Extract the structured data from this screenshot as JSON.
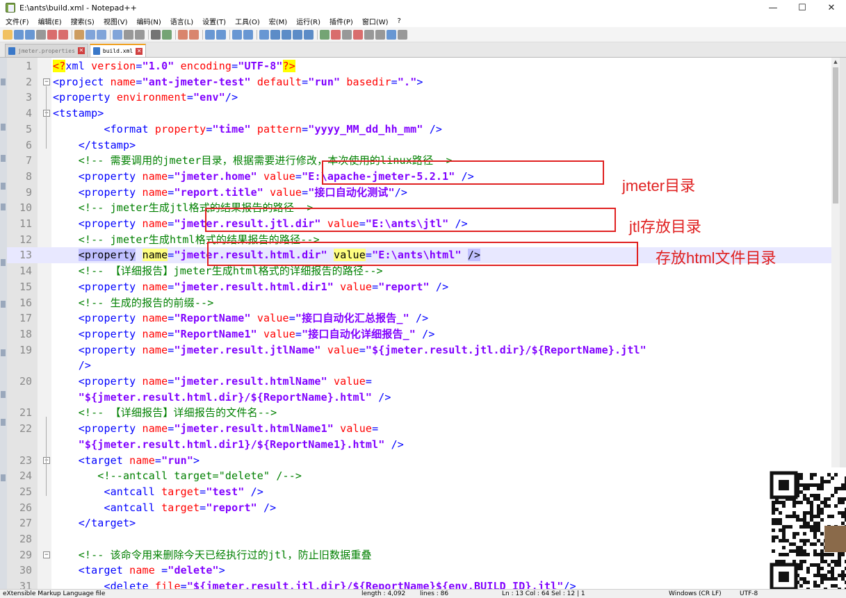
{
  "window": {
    "title": "E:\\ants\\build.xml - Notepad++",
    "controls": [
      "—",
      "☐",
      "✕"
    ]
  },
  "menu": [
    "文件(F)",
    "编辑(E)",
    "搜索(S)",
    "视图(V)",
    "编码(N)",
    "语言(L)",
    "设置(T)",
    "工具(O)",
    "宏(M)",
    "运行(R)",
    "插件(P)",
    "窗口(W)",
    "?"
  ],
  "tabs": [
    {
      "label": "jmeter.properties",
      "active": false
    },
    {
      "label": "build.xml",
      "active": true
    }
  ],
  "colors": {
    "annotation": "#e02020",
    "current_line": "#e8e8ff",
    "tag": "#0000ff",
    "attribute": "#ff0000",
    "value": "#8000ff",
    "comment": "#008000"
  },
  "editor": {
    "current_line": 13,
    "lines": [
      {
        "n": "1",
        "t": [
          [
            "pi",
            "<?"
          ],
          [
            "tag",
            "xml "
          ],
          [
            "attr",
            "version"
          ],
          [
            "tag",
            "="
          ],
          [
            "val",
            "\"1.0\""
          ],
          [
            "tag",
            " "
          ],
          [
            "attr",
            "encoding"
          ],
          [
            "tag",
            "="
          ],
          [
            "val",
            "\"UTF-8\""
          ],
          [
            "pi",
            "?>"
          ]
        ]
      },
      {
        "n": "2",
        "t": [
          [
            "tag",
            "<project "
          ],
          [
            "attr",
            "name"
          ],
          [
            "tag",
            "="
          ],
          [
            "val",
            "\"ant-jmeter-test\""
          ],
          [
            "tag",
            " "
          ],
          [
            "attr",
            "default"
          ],
          [
            "tag",
            "="
          ],
          [
            "val",
            "\"run\""
          ],
          [
            "tag",
            " "
          ],
          [
            "attr",
            "basedir"
          ],
          [
            "tag",
            "="
          ],
          [
            "val",
            "\".\""
          ],
          [
            "tag",
            ">"
          ]
        ]
      },
      {
        "n": "3",
        "t": [
          [
            "tag",
            "<property "
          ],
          [
            "attr",
            "environment"
          ],
          [
            "tag",
            "="
          ],
          [
            "val",
            "\"env\""
          ],
          [
            "tag",
            "/>"
          ]
        ]
      },
      {
        "n": "4",
        "t": [
          [
            "tag",
            "<tstamp>"
          ]
        ]
      },
      {
        "n": "5",
        "t": [
          [
            "tag",
            "        <format "
          ],
          [
            "attr",
            "property"
          ],
          [
            "tag",
            "="
          ],
          [
            "val",
            "\"time\""
          ],
          [
            "tag",
            " "
          ],
          [
            "attr",
            "pattern"
          ],
          [
            "tag",
            "="
          ],
          [
            "val",
            "\"yyyy_MM_dd_hh_mm\""
          ],
          [
            "tag",
            " />"
          ]
        ]
      },
      {
        "n": "6",
        "t": [
          [
            "tag",
            "    </tstamp>"
          ]
        ]
      },
      {
        "n": "7",
        "t": [
          [
            "cmt",
            "    <!-- 需要调用的jmeter目录，根据需要进行修改，本次使用的linux路径-->"
          ]
        ]
      },
      {
        "n": "8",
        "t": [
          [
            "tag",
            "    <property "
          ],
          [
            "attr",
            "name"
          ],
          [
            "tag",
            "="
          ],
          [
            "val",
            "\"jmeter.home\""
          ],
          [
            "tag",
            " "
          ],
          [
            "attr",
            "value"
          ],
          [
            "tag",
            "="
          ],
          [
            "val",
            "\"E:\\apache-jmeter-5.2.1\""
          ],
          [
            "tag",
            " />"
          ]
        ]
      },
      {
        "n": "9",
        "t": [
          [
            "tag",
            "    <property "
          ],
          [
            "attr",
            "name"
          ],
          [
            "tag",
            "="
          ],
          [
            "val",
            "\"report.title\""
          ],
          [
            "tag",
            " "
          ],
          [
            "attr",
            "value"
          ],
          [
            "tag",
            "="
          ],
          [
            "val",
            "\"接口自动化测试\""
          ],
          [
            "tag",
            "/>"
          ]
        ]
      },
      {
        "n": "10",
        "t": [
          [
            "cmt",
            "    <!-- jmeter生成jtl格式的结果报告的路径-->"
          ]
        ]
      },
      {
        "n": "11",
        "t": [
          [
            "tag",
            "    <property "
          ],
          [
            "attr",
            "name"
          ],
          [
            "tag",
            "="
          ],
          [
            "val",
            "\"jmeter.result.jtl.dir\""
          ],
          [
            "tag",
            " "
          ],
          [
            "attr",
            "value"
          ],
          [
            "tag",
            "="
          ],
          [
            "val",
            "\"E:\\ants\\jtl\""
          ],
          [
            "tag",
            " />"
          ]
        ]
      },
      {
        "n": "12",
        "t": [
          [
            "cmt",
            "    <!-- jmeter生成html格式的结果报告的路径-->"
          ]
        ]
      },
      {
        "n": "13",
        "t": [
          [
            "tag",
            "    "
          ],
          [
            "sel",
            "<property"
          ],
          [
            "tag",
            " "
          ],
          [
            "sel-y",
            "name"
          ],
          [
            "tag",
            "="
          ],
          [
            "val",
            "\"jmeter.result.html.dir\""
          ],
          [
            "tag",
            " "
          ],
          [
            "sel-y",
            "value"
          ],
          [
            "tag",
            "="
          ],
          [
            "val",
            "\"E:\\ants\\html\""
          ],
          [
            "tag",
            " "
          ],
          [
            "sel",
            "/>"
          ]
        ]
      },
      {
        "n": "14",
        "t": [
          [
            "cmt",
            "    <!-- 【详细报告】jmeter生成html格式的详细报告的路径-->"
          ]
        ]
      },
      {
        "n": "15",
        "t": [
          [
            "tag",
            "    <property "
          ],
          [
            "attr",
            "name"
          ],
          [
            "tag",
            "="
          ],
          [
            "val",
            "\"jmeter.result.html.dir1\""
          ],
          [
            "tag",
            " "
          ],
          [
            "attr",
            "value"
          ],
          [
            "tag",
            "="
          ],
          [
            "val",
            "\"report\""
          ],
          [
            "tag",
            " />"
          ]
        ]
      },
      {
        "n": "16",
        "t": [
          [
            "cmt",
            "    <!-- 生成的报告的前缀-->"
          ]
        ]
      },
      {
        "n": "17",
        "t": [
          [
            "tag",
            "    <property "
          ],
          [
            "attr",
            "name"
          ],
          [
            "tag",
            "="
          ],
          [
            "val",
            "\"ReportName\""
          ],
          [
            "tag",
            " "
          ],
          [
            "attr",
            "value"
          ],
          [
            "tag",
            "="
          ],
          [
            "val",
            "\"接口自动化汇总报告_\""
          ],
          [
            "tag",
            " />"
          ]
        ]
      },
      {
        "n": "18",
        "t": [
          [
            "tag",
            "    <property "
          ],
          [
            "attr",
            "name"
          ],
          [
            "tag",
            "="
          ],
          [
            "val",
            "\"ReportName1\""
          ],
          [
            "tag",
            " "
          ],
          [
            "attr",
            "value"
          ],
          [
            "tag",
            "="
          ],
          [
            "val",
            "\"接口自动化详细报告_\""
          ],
          [
            "tag",
            " />"
          ]
        ]
      },
      {
        "n": "19",
        "t": [
          [
            "tag",
            "    <property "
          ],
          [
            "attr",
            "name"
          ],
          [
            "tag",
            "="
          ],
          [
            "val",
            "\"jmeter.result.jtlName\""
          ],
          [
            "tag",
            " "
          ],
          [
            "attr",
            "value"
          ],
          [
            "tag",
            "="
          ],
          [
            "val",
            "\"${jmeter.result.jtl.dir}/${ReportName}.jtl\""
          ]
        ]
      },
      {
        "n": "",
        "t": [
          [
            "tag",
            "    />"
          ]
        ]
      },
      {
        "n": "20",
        "t": [
          [
            "tag",
            "    <property "
          ],
          [
            "attr",
            "name"
          ],
          [
            "tag",
            "="
          ],
          [
            "val",
            "\"jmeter.result.htmlName\""
          ],
          [
            "tag",
            " "
          ],
          [
            "attr",
            "value"
          ],
          [
            "tag",
            "="
          ]
        ]
      },
      {
        "n": "",
        "t": [
          [
            "val",
            "    \"${jmeter.result.html.dir}/${ReportName}.html\""
          ],
          [
            "tag",
            " />"
          ]
        ]
      },
      {
        "n": "21",
        "t": [
          [
            "cmt",
            "    <!-- 【详细报告】详细报告的文件名-->"
          ]
        ]
      },
      {
        "n": "22",
        "t": [
          [
            "tag",
            "    <property "
          ],
          [
            "attr",
            "name"
          ],
          [
            "tag",
            "="
          ],
          [
            "val",
            "\"jmeter.result.htmlName1\""
          ],
          [
            "tag",
            " "
          ],
          [
            "attr",
            "value"
          ],
          [
            "tag",
            "="
          ]
        ]
      },
      {
        "n": "",
        "t": [
          [
            "val",
            "    \"${jmeter.result.html.dir1}/${ReportName1}.html\""
          ],
          [
            "tag",
            " />"
          ]
        ]
      },
      {
        "n": "23",
        "t": [
          [
            "tag",
            "    <target "
          ],
          [
            "attr",
            "name"
          ],
          [
            "tag",
            "="
          ],
          [
            "val",
            "\"run\""
          ],
          [
            "tag",
            ">"
          ]
        ]
      },
      {
        "n": "24",
        "t": [
          [
            "cmt",
            "       <!--antcall target=\"delete\" /-->"
          ]
        ]
      },
      {
        "n": "25",
        "t": [
          [
            "tag",
            "        <antcall "
          ],
          [
            "attr",
            "target"
          ],
          [
            "tag",
            "="
          ],
          [
            "val",
            "\"test\""
          ],
          [
            "tag",
            " />"
          ]
        ]
      },
      {
        "n": "26",
        "t": [
          [
            "tag",
            "        <antcall "
          ],
          [
            "attr",
            "target"
          ],
          [
            "tag",
            "="
          ],
          [
            "val",
            "\"report\""
          ],
          [
            "tag",
            " />"
          ]
        ]
      },
      {
        "n": "27",
        "t": [
          [
            "tag",
            "    </target>"
          ]
        ]
      },
      {
        "n": "28",
        "t": []
      },
      {
        "n": "29",
        "t": [
          [
            "cmt",
            "    <!-- 该命令用来删除今天已经执行过的jtl，防止旧数据重叠"
          ]
        ]
      },
      {
        "n": "30",
        "t": [
          [
            "tag",
            "    <target "
          ],
          [
            "attr",
            "name "
          ],
          [
            "tag",
            "="
          ],
          [
            "val",
            "\"delete\""
          ],
          [
            "tag",
            ">"
          ]
        ]
      },
      {
        "n": "31",
        "t": [
          [
            "tag",
            "        <delete "
          ],
          [
            "attr",
            "file"
          ],
          [
            "tag",
            "="
          ],
          [
            "val",
            "\"${jmeter.result.jtl.dir}/${ReportName}${env.BUILD_ID}.jtl\""
          ],
          [
            "tag",
            "/>"
          ]
        ]
      }
    ]
  },
  "annotations": [
    {
      "label": "jmeter目录"
    },
    {
      "label": "jtl存放目录"
    },
    {
      "label": "存放html文件目录"
    }
  ],
  "status": {
    "language": "eXtensible Markup Language file",
    "length": "length : 4,092",
    "lines": "lines : 86",
    "position": "Ln : 13    Col : 64    Sel : 12 | 1",
    "eol": "Windows (CR LF)",
    "encoding": "UTF-8"
  }
}
